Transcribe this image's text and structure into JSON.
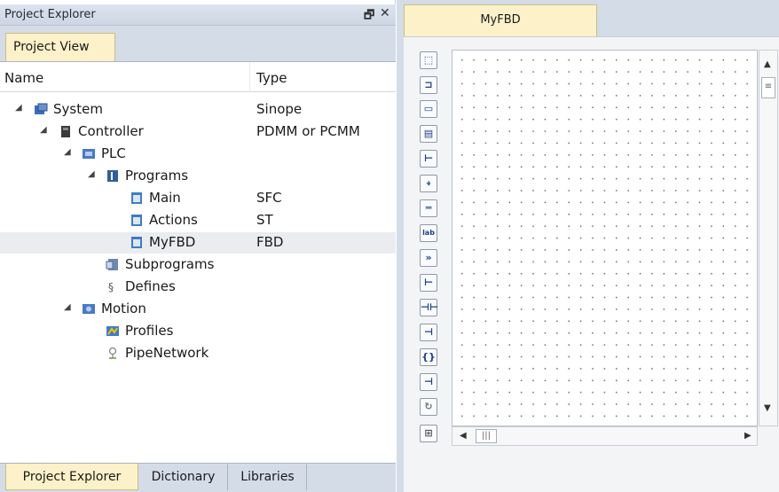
{
  "project_explorer": {
    "title": "Project Explorer",
    "pin_icon": "pin-icon",
    "close_icon": "close-icon",
    "view_tab": "Project View",
    "columns": {
      "name": "Name",
      "type": "Type"
    },
    "tree": [
      {
        "label": "System",
        "type": "Sinope",
        "icon": "system-icon",
        "expanded": true
      },
      {
        "label": "Controller",
        "type": "PDMM or PCMM",
        "icon": "controller-icon",
        "expanded": true
      },
      {
        "label": "PLC",
        "type": "",
        "icon": "plc-icon",
        "expanded": true
      },
      {
        "label": "Programs",
        "type": "",
        "icon": "programs-icon",
        "expanded": true
      },
      {
        "label": "Main",
        "type": "SFC",
        "icon": "program-icon"
      },
      {
        "label": "Actions",
        "type": "ST",
        "icon": "program-icon"
      },
      {
        "label": "MyFBD",
        "type": "FBD",
        "icon": "program-icon",
        "selected": true
      },
      {
        "label": "Subprograms",
        "type": "",
        "icon": "subprograms-icon"
      },
      {
        "label": "Defines",
        "type": "",
        "icon": "defines-icon"
      },
      {
        "label": "Motion",
        "type": "",
        "icon": "motion-icon",
        "expanded": true
      },
      {
        "label": "Profiles",
        "type": "",
        "icon": "profiles-icon"
      },
      {
        "label": "PipeNetwork",
        "type": "",
        "icon": "pipenetwork-icon"
      }
    ],
    "bottom_tabs": [
      "Project Explorer",
      "Dictionary",
      "Libraries"
    ],
    "active_bottom_tab": "Project Explorer"
  },
  "editor": {
    "doc_tab": "MyFBD",
    "toolbar_icons": [
      "selection-icon",
      "function-block-icon",
      "variable-icon",
      "comment-icon",
      "corner-icon",
      "junction-icon",
      "horizontal-line-icon",
      "label-icon",
      "jump-icon",
      "left-rail-icon",
      "contact-icon",
      "coil-icon",
      "return-icon",
      "right-rail-icon",
      "loop-icon",
      "network-icon"
    ],
    "toolbar_glyphs": [
      "⬚",
      "⊐",
      "▭",
      "▤",
      "⊢",
      "⍖",
      "═",
      "lab",
      "»",
      "⊢",
      "⊣⊢",
      "⊣",
      "{}",
      "⊣",
      "↻",
      "⊞"
    ]
  },
  "colors": {
    "panel_bg": "#d4dce8",
    "active_tab": "#fdf1c9",
    "selection": "#eaecef"
  }
}
